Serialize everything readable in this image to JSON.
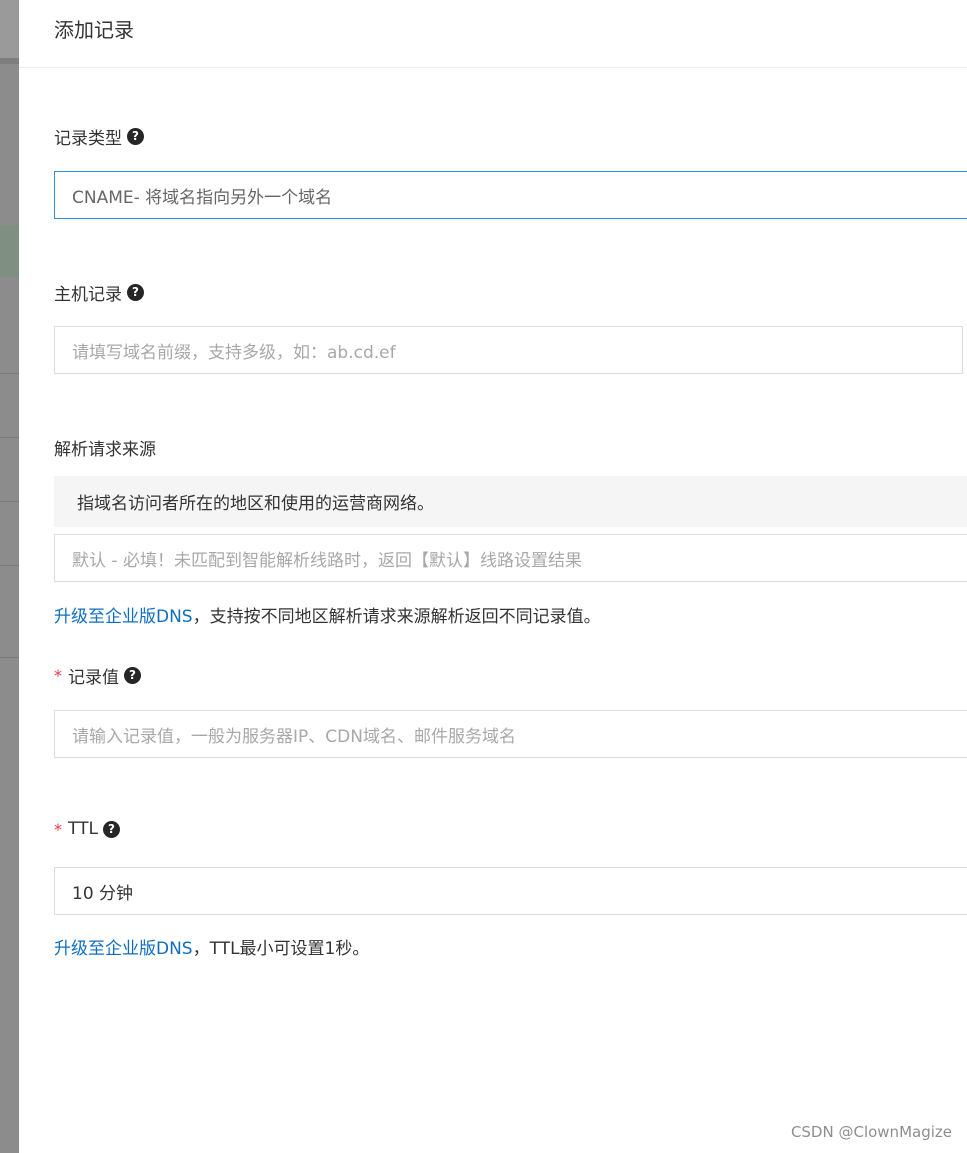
{
  "dialog": {
    "title": "添加记录"
  },
  "record_type": {
    "label": "记录类型",
    "value": "CNAME- 将域名指向另外一个域名"
  },
  "host_record": {
    "label": "主机记录",
    "placeholder": "请填写域名前缀，支持多级，如：ab.cd.ef"
  },
  "resolution_source": {
    "label": "解析请求来源",
    "tip": "指域名访问者所在的地区和使用的运营商网络。",
    "value": "默认 - 必填！未匹配到智能解析线路时，返回【默认】线路设置结果",
    "upgrade_link": "升级至企业版DNS",
    "upgrade_text": "，支持按不同地区解析请求来源解析返回不同记录值。"
  },
  "record_value": {
    "required_mark": "*",
    "label": "记录值",
    "placeholder": "请输入记录值，一般为服务器IP、CDN域名、邮件服务域名"
  },
  "ttl": {
    "required_mark": "*",
    "label": "TTL",
    "value": "10 分钟",
    "upgrade_link": "升级至企业版DNS",
    "upgrade_text": "，TTL最小可设置1秒。"
  },
  "help_icon_glyph": "?",
  "watermark": "CSDN @ClownMagize"
}
